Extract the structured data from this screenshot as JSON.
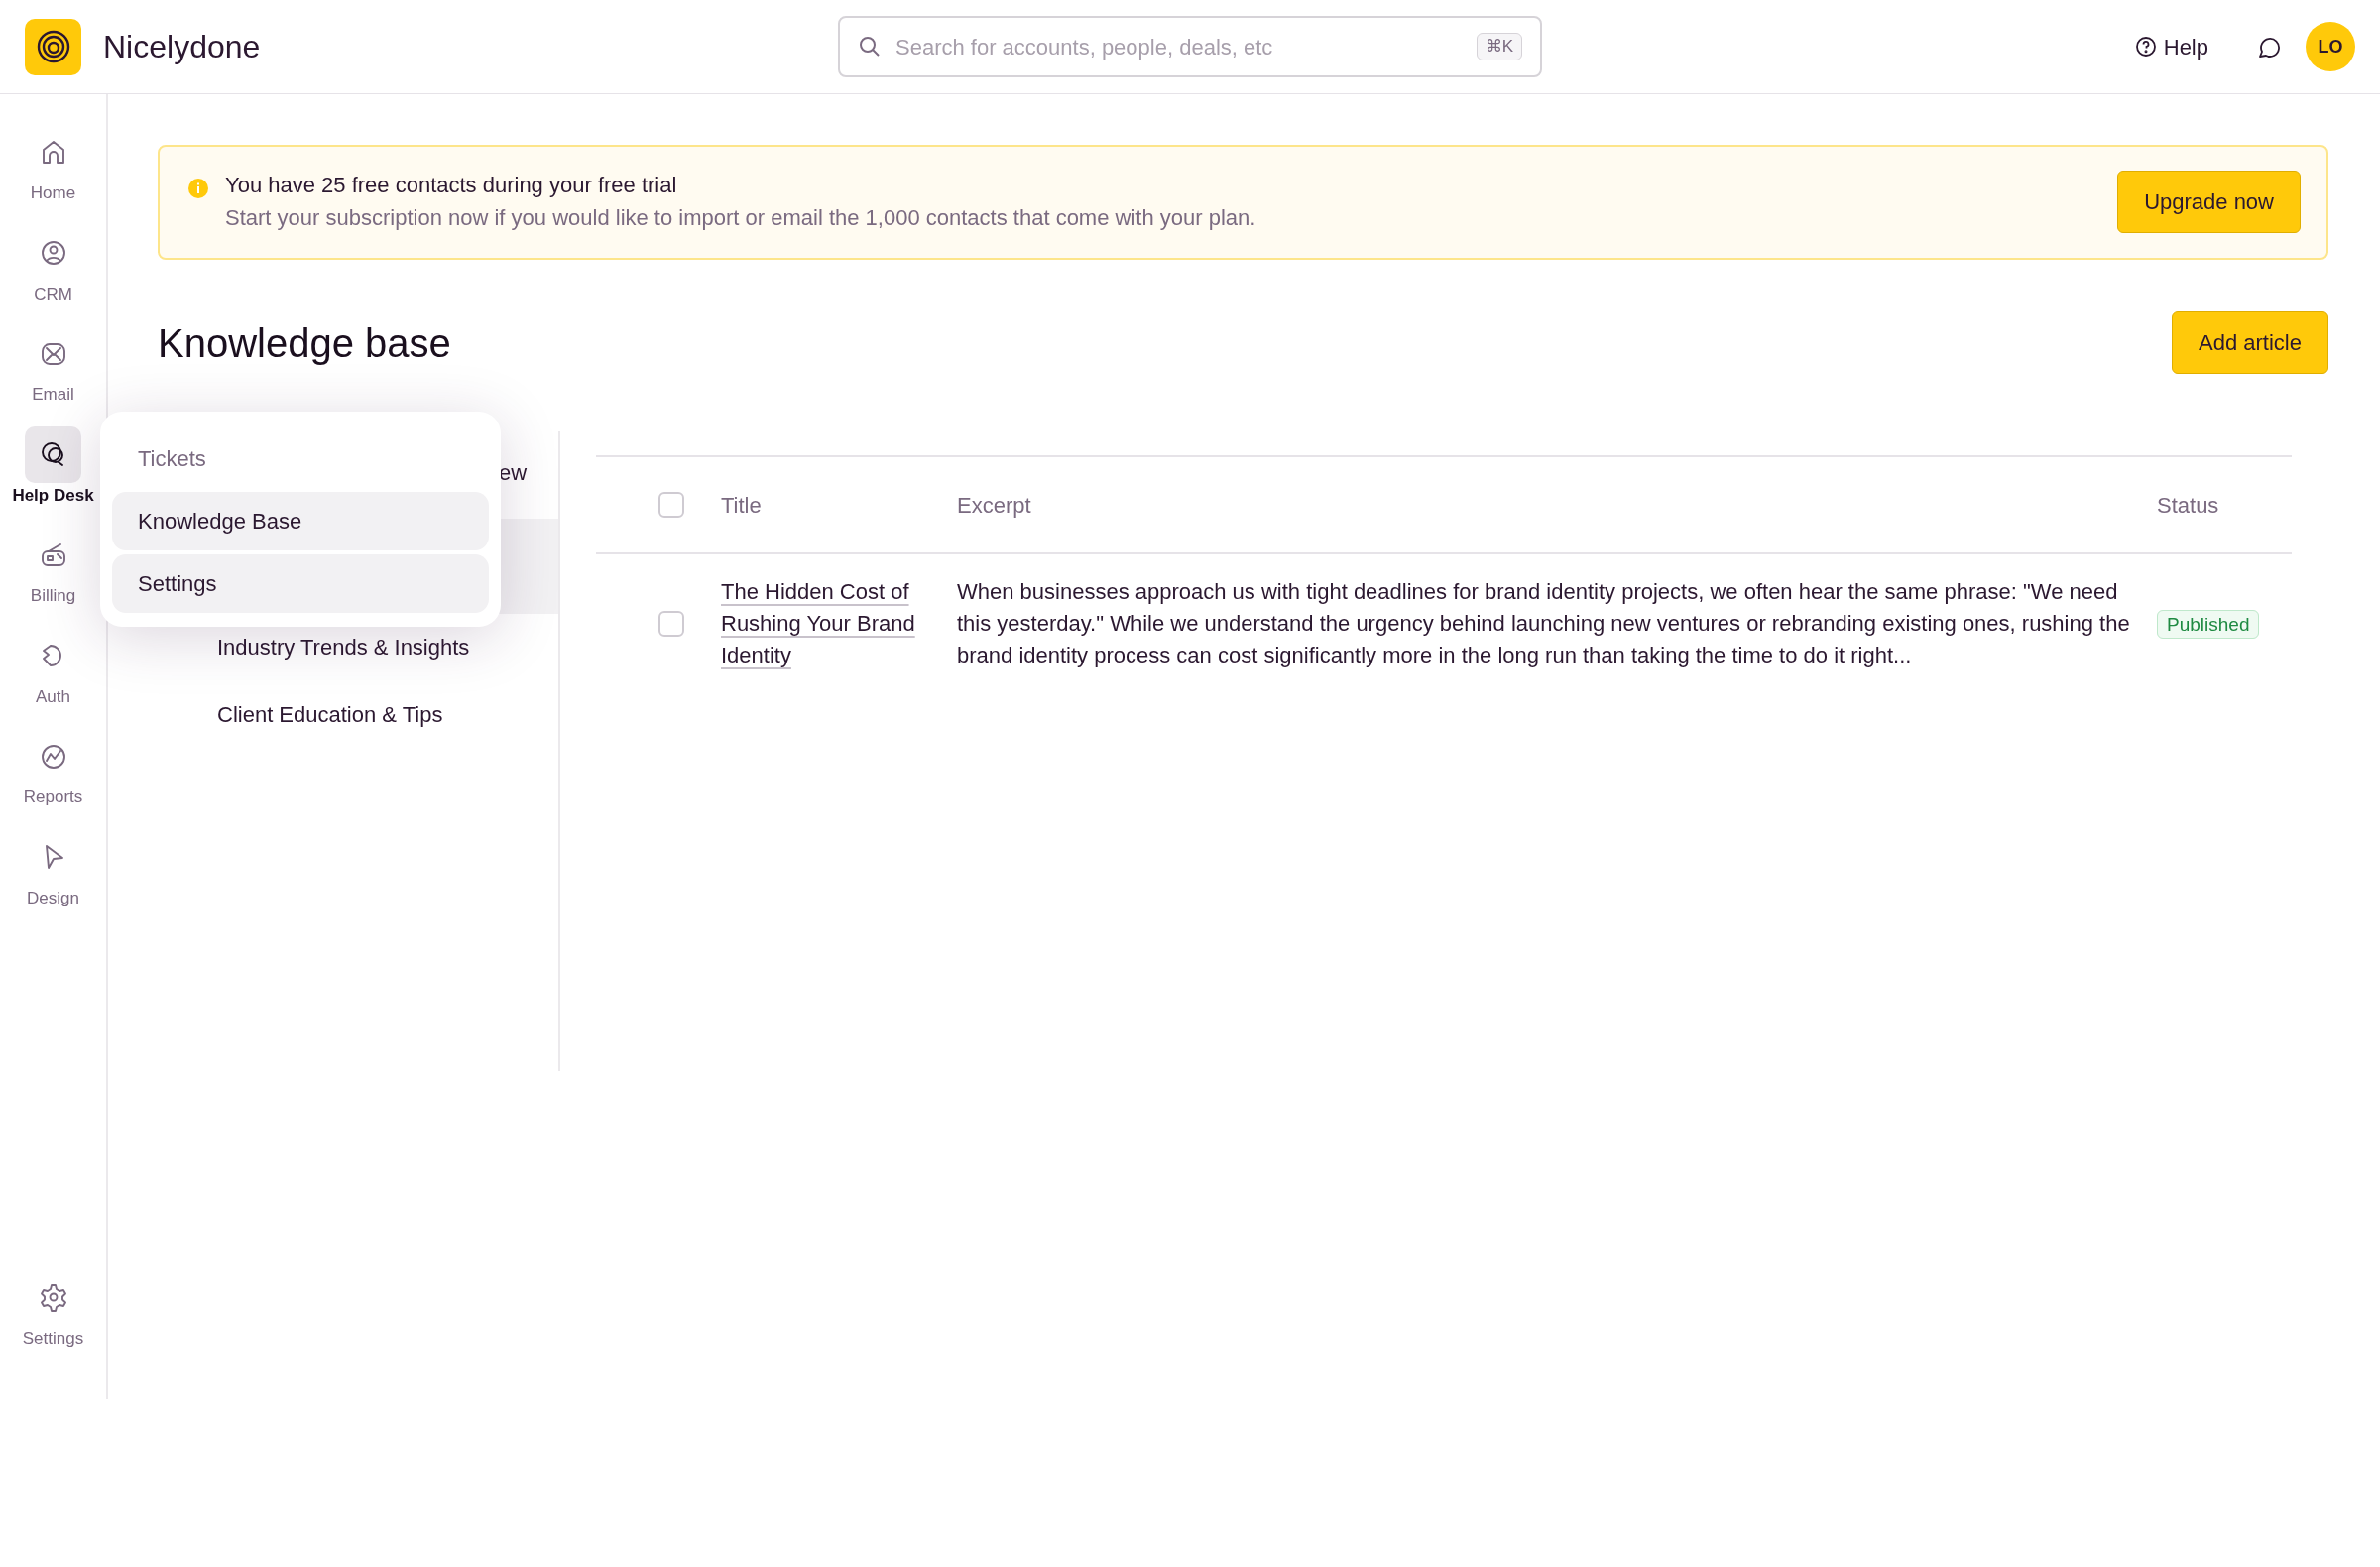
{
  "app": {
    "name": "Nicelydone"
  },
  "search": {
    "placeholder": "Search for accounts, people, deals, etc",
    "shortcut": "⌘K"
  },
  "header": {
    "help": "Help",
    "avatar": "LO"
  },
  "sidebar": {
    "items": [
      {
        "label": "Home",
        "selected": false
      },
      {
        "label": "CRM",
        "selected": false
      },
      {
        "label": "Email",
        "selected": false
      },
      {
        "label": "Help Desk",
        "selected": true
      },
      {
        "label": "Billing",
        "selected": false
      },
      {
        "label": "Auth",
        "selected": false
      },
      {
        "label": "Reports",
        "selected": false
      },
      {
        "label": "Design",
        "selected": false
      }
    ],
    "bottom": {
      "label": "Settings",
      "selected": false
    }
  },
  "flyout": {
    "items": [
      {
        "label": "Tickets",
        "highlighted": false
      },
      {
        "label": "Knowledge Base",
        "highlighted": true
      },
      {
        "label": "Settings",
        "highlighted": true
      }
    ]
  },
  "banner": {
    "title": "You have 25 free contacts during your free trial",
    "text": "Start your subscription now if you would like to import or email the 1,000 contacts that come with your plan.",
    "button": "Upgrade now"
  },
  "page": {
    "title": "Knowledge base",
    "button": "Add article"
  },
  "categories": [
    {
      "label": "ew",
      "selected": false
    },
    {
      "selected": true
    },
    {
      "label": "Industry Trends & Insights",
      "selected": false
    },
    {
      "label": "Client Education & Tips",
      "selected": false
    }
  ],
  "table": {
    "columns": [
      "Title",
      "Excerpt",
      "Status"
    ],
    "header_checked": false,
    "rows": [
      {
        "checked": false,
        "title": "The Hidden Cost of Rushing Your Brand Identity",
        "excerpt": "When businesses approach us with tight deadlines for brand identity projects, we often hear the same phrase: \"We need this yesterday.\" While we understand the urgency behind launching new ventures or rebranding existing ones, rushing the brand identity process can cost significantly more in the long run than taking the time to do it right...",
        "status": "Published"
      }
    ]
  }
}
